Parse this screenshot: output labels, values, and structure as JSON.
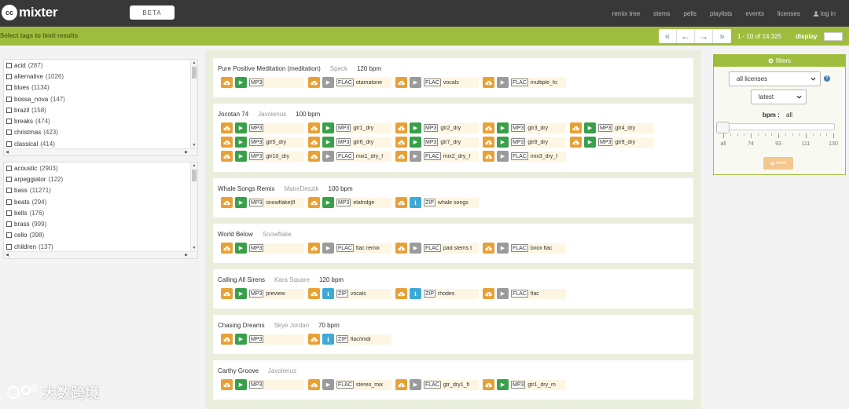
{
  "header": {
    "logo_mark": "cc",
    "logo_text": "mixter",
    "beta": "BETA",
    "nav": [
      "remix tree",
      "stems",
      "pells",
      "playlists",
      "events",
      "licenses"
    ],
    "login": "log in"
  },
  "toolbar": {
    "hint": "Select tags to limit results",
    "pager": {
      "first": "«",
      "prev": "←",
      "next": "→",
      "last": "»"
    },
    "range": "1 - 10 of 14,325",
    "display_label": "display",
    "display_value": ""
  },
  "tag_lists": [
    {
      "items": [
        {
          "name": "acid",
          "count": "(287)"
        },
        {
          "name": "alternative",
          "count": "(1026)"
        },
        {
          "name": "blues",
          "count": "(1134)"
        },
        {
          "name": "bossa_nova",
          "count": "(147)"
        },
        {
          "name": "brazil",
          "count": "(158)"
        },
        {
          "name": "breaks",
          "count": "(474)"
        },
        {
          "name": "christmas",
          "count": "(423)"
        },
        {
          "name": "classical",
          "count": "(414)"
        }
      ]
    },
    {
      "items": [
        {
          "name": "acoustic",
          "count": "(2903)"
        },
        {
          "name": "arpeggiator",
          "count": "(122)"
        },
        {
          "name": "bass",
          "count": "(11271)"
        },
        {
          "name": "beats",
          "count": "(294)"
        },
        {
          "name": "bells",
          "count": "(176)"
        },
        {
          "name": "brass",
          "count": "(999)"
        },
        {
          "name": "cello",
          "count": "(398)"
        },
        {
          "name": "children",
          "count": "(137)"
        }
      ]
    }
  ],
  "uploads": [
    {
      "title": "Pure Positive Meditation (meditation)",
      "artist": "Speck",
      "bpm": "120 bpm",
      "files": [
        {
          "kind": "play",
          "format": "MP3",
          "name": ""
        },
        {
          "kind": "stop",
          "format": "FLAC",
          "name": "otamatone"
        },
        {
          "kind": "stop",
          "format": "FLAC",
          "name": "vocals"
        },
        {
          "kind": "stop",
          "format": "FLAC",
          "name": "multiple_fo"
        }
      ]
    },
    {
      "title": "Jocotan 74",
      "artist": "Javolenus",
      "bpm": "100 bpm",
      "files": [
        {
          "kind": "play",
          "format": "MP3",
          "name": ""
        },
        {
          "kind": "play",
          "format": "MP3",
          "name": "gtr1_dry"
        },
        {
          "kind": "play",
          "format": "MP3",
          "name": "gtr2_dry"
        },
        {
          "kind": "play",
          "format": "MP3",
          "name": "gtr3_dry"
        },
        {
          "kind": "play",
          "format": "MP3",
          "name": "gtr4_dry"
        },
        {
          "kind": "play",
          "format": "MP3",
          "name": "gtr5_dry"
        },
        {
          "kind": "play",
          "format": "MP3",
          "name": "gtr6_dry"
        },
        {
          "kind": "play",
          "format": "MP3",
          "name": "gtr7_dry"
        },
        {
          "kind": "play",
          "format": "MP3",
          "name": "gtr8_dry"
        },
        {
          "kind": "play",
          "format": "MP3",
          "name": "gtr9_dry"
        },
        {
          "kind": "play",
          "format": "MP3",
          "name": "gtr10_dry"
        },
        {
          "kind": "stop",
          "format": "FLAC",
          "name": "mix1_dry_f"
        },
        {
          "kind": "stop",
          "format": "FLAC",
          "name": "mix2_dry_f"
        },
        {
          "kind": "stop",
          "format": "FLAC",
          "name": "mix3_dry_f"
        }
      ]
    },
    {
      "title": "Whale Songs Remix",
      "artist": "MaireDeszik",
      "bpm": "100 bpm",
      "files": [
        {
          "kind": "play",
          "format": "MP3",
          "name": "snowflake(fl"
        },
        {
          "kind": "play",
          "format": "MP3",
          "name": "elafridge"
        },
        {
          "kind": "info",
          "format": "ZIP",
          "name": "whale songs"
        }
      ]
    },
    {
      "title": "World Below",
      "artist": "Snowflake",
      "bpm": "",
      "files": [
        {
          "kind": "play",
          "format": "MP3",
          "name": ""
        },
        {
          "kind": "stop",
          "format": "FLAC",
          "name": "flac remix"
        },
        {
          "kind": "stop",
          "format": "FLAC",
          "name": "pad stems t"
        },
        {
          "kind": "stop",
          "format": "FLAC",
          "name": "bvox flac"
        }
      ]
    },
    {
      "title": "Calling All Sirens",
      "artist": "Kara Square",
      "bpm": "120 bpm",
      "files": [
        {
          "kind": "play",
          "format": "MP3",
          "name": "preview"
        },
        {
          "kind": "info",
          "format": "ZIP",
          "name": "vocals"
        },
        {
          "kind": "info",
          "format": "ZIP",
          "name": "rhodes"
        },
        {
          "kind": "stop",
          "format": "FLAC",
          "name": "flac"
        }
      ]
    },
    {
      "title": "Chasing Dreams",
      "artist": "Skye Jordan",
      "bpm": "70 bpm",
      "files": [
        {
          "kind": "play",
          "format": "MP3",
          "name": ""
        },
        {
          "kind": "info",
          "format": "ZIP",
          "name": "flac/midi"
        }
      ]
    },
    {
      "title": "Carthy Groove",
      "artist": "Javolenus",
      "bpm": "",
      "files": [
        {
          "kind": "play",
          "format": "MP3",
          "name": ""
        },
        {
          "kind": "stop",
          "format": "FLAC",
          "name": "stereo_mix"
        },
        {
          "kind": "stop",
          "format": "FLAC",
          "name": "gtr_dry1_fl"
        },
        {
          "kind": "play",
          "format": "MP3",
          "name": "gtr1_dry_m"
        }
      ]
    }
  ],
  "filters": {
    "title": "filters",
    "license_select": "all licenses",
    "sort_select": "latest",
    "help": "?",
    "bpm_label": "bpm :",
    "bpm_value": "all",
    "slider_level": 0,
    "tick_labels": [
      "all",
      "74",
      "93",
      "111",
      "130"
    ],
    "reset": "reset"
  },
  "watermark": "大数跨境",
  "colors": {
    "accent_green": "#9fbd3d",
    "download_orange": "#e8a135",
    "play_green": "#39a04a",
    "info_blue": "#3fa9d6",
    "header_dark": "#383838"
  }
}
